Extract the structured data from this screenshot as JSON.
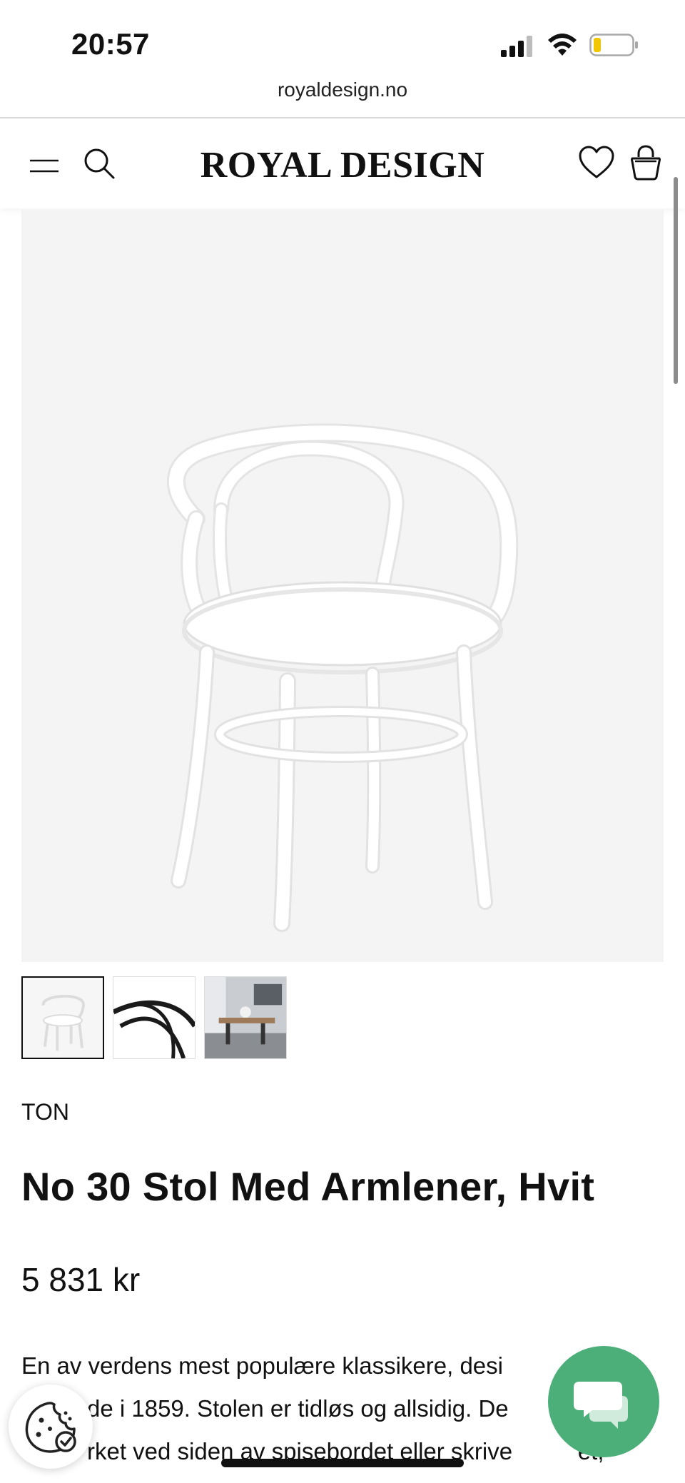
{
  "status_bar": {
    "time": "20:57"
  },
  "browser": {
    "url": "royaldesign.no"
  },
  "header": {
    "logo": "ROYAL DESIGN",
    "icons": [
      "menu-icon",
      "search-icon",
      "heart-icon",
      "bag-icon"
    ]
  },
  "product": {
    "brand": "TON",
    "title": "No 30 Stol Med Armlener, Hvit",
    "price": "5 831 kr",
    "description_lines": [
      "En av verdens mest populære klassikere, desi",
      "de i 1859. Stolen er tidløs og allsidig. De",
      "rket ved siden av spisebordet eller skrive          et,"
    ],
    "thumbnails": [
      "Hvit stol",
      "Svart stol detalj",
      "Spisestue miljø"
    ]
  },
  "floating": {
    "cookie_icon": "cookie-settings-icon",
    "chat_icon": "chat-bubble-icon",
    "chat_color": "#4caf7a"
  }
}
